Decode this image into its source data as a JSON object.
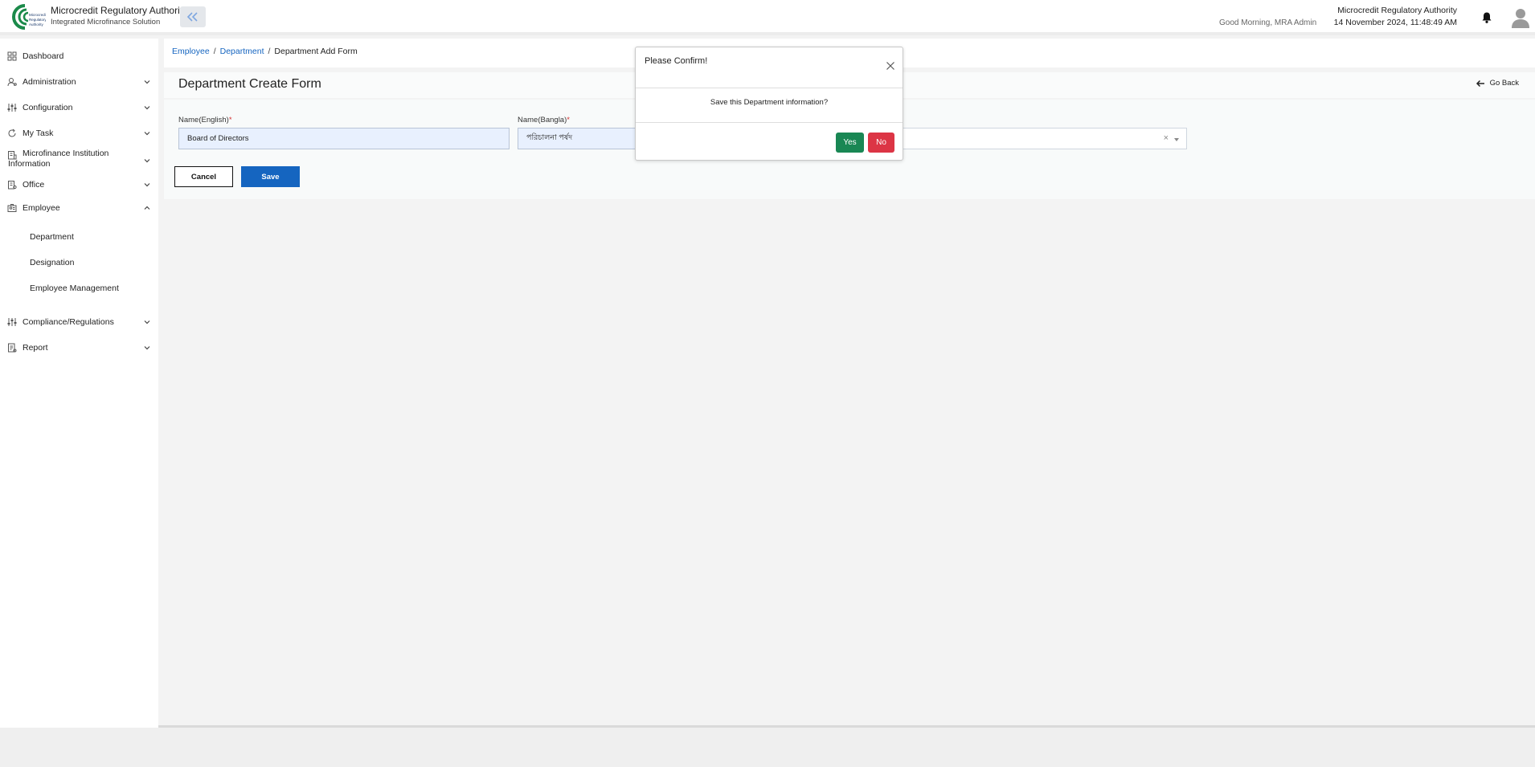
{
  "header": {
    "logo_text": "Microcredit Regulatory Authority",
    "brand_title": "Microcredit Regulatory Authority",
    "brand_subtitle": "Integrated Microfinance Solution",
    "greeting": "Good Morning, MRA Admin",
    "org_name": "Microcredit Regulatory Authority",
    "datetime": "14 November 2024, 11:48:49 AM"
  },
  "sidebar": {
    "items": [
      {
        "label": "Dashboard",
        "icon": "grid-icon"
      },
      {
        "label": "Administration",
        "icon": "user-gear-icon"
      },
      {
        "label": "Configuration",
        "icon": "sliders-icon"
      },
      {
        "label": "My Task",
        "icon": "refresh-icon"
      },
      {
        "label": "Microfinance Institution",
        "label2": "Information",
        "icon": "building-icon"
      },
      {
        "label": "Office",
        "icon": "office-icon"
      },
      {
        "label": "Employee",
        "icon": "employee-icon"
      },
      {
        "label": "Compliance/Regulations",
        "icon": "sliders-icon"
      },
      {
        "label": "Report",
        "icon": "report-icon"
      }
    ],
    "employee_sub": [
      "Department",
      "Designation",
      "Employee Management"
    ]
  },
  "breadcrumb": {
    "items": [
      "Employee",
      "Department"
    ],
    "current": "Department Add Form"
  },
  "form": {
    "title": "Department Create Form",
    "go_back": "Go Back",
    "name_english_label": "Name(English)",
    "name_english_value": "Board of Directors",
    "name_bangla_label": "Name(Bangla)",
    "name_bangla_value": "পরিচালনা পর্ষদ",
    "required_mark": "*",
    "select_clear": "×",
    "cancel_label": "Cancel",
    "save_label": "Save"
  },
  "modal": {
    "title": "Please Confirm!",
    "message": "Save this Department information?",
    "yes_label": "Yes",
    "no_label": "No"
  },
  "colors": {
    "primary": "#1565c0",
    "yes": "#198754",
    "no": "#dc3545",
    "input_bg": "#e8f0fe"
  }
}
